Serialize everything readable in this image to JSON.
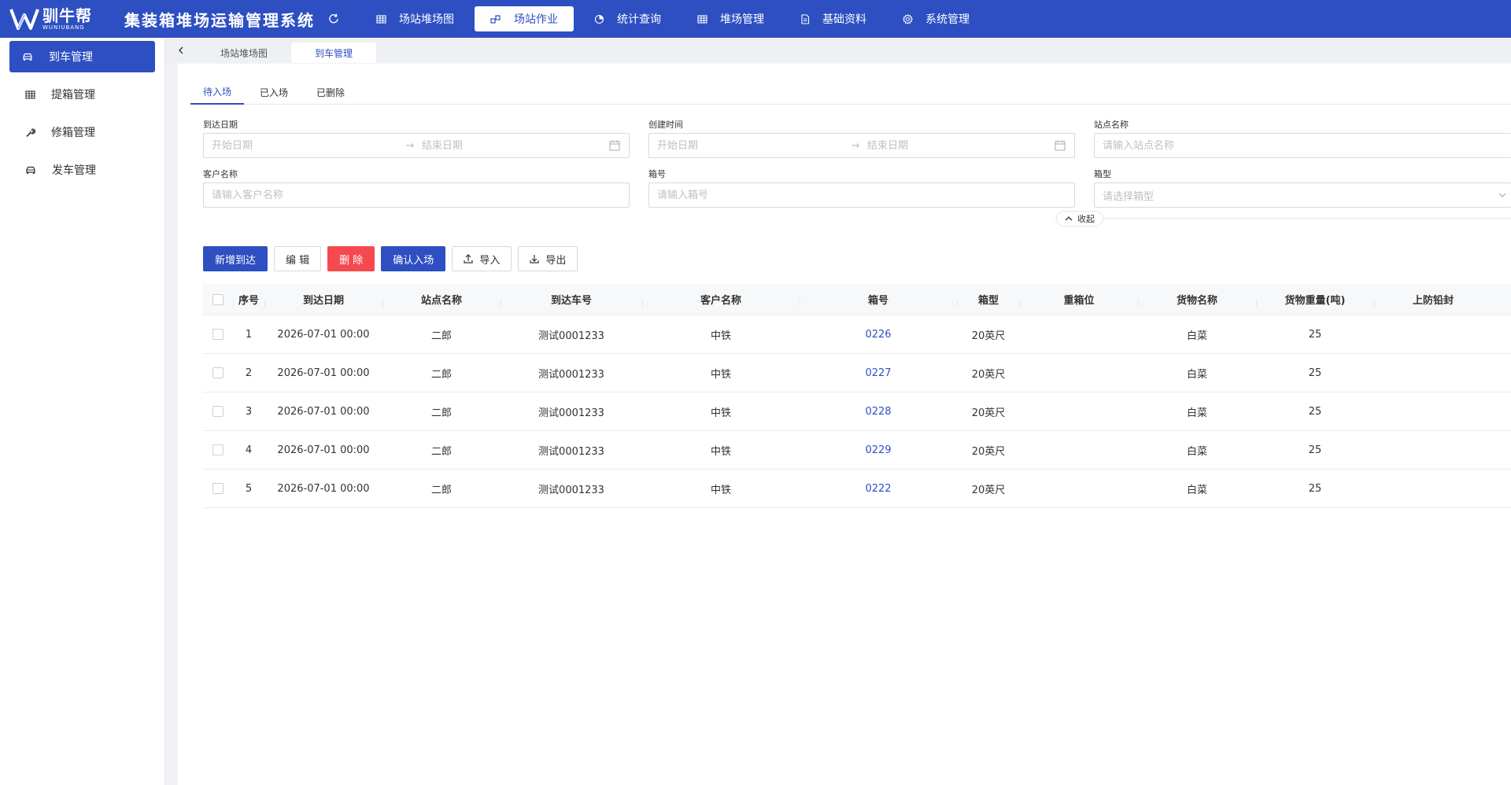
{
  "brand": {
    "name_cn": "驯牛帮",
    "name_en": "WUNIUBANG",
    "system_title": "集装箱堆场运输管理系统"
  },
  "colors": {
    "primary": "#2d4fc2",
    "danger": "#f5494f",
    "link": "#2d4fc2"
  },
  "nav": [
    {
      "label": "场站堆场图",
      "icon": "grid-icon",
      "active": false
    },
    {
      "label": "场站作业",
      "icon": "workflow-icon",
      "active": true
    },
    {
      "label": "统计查询",
      "icon": "pie-chart-icon",
      "active": false
    },
    {
      "label": "堆场管理",
      "icon": "grid-icon",
      "active": false
    },
    {
      "label": "基础资料",
      "icon": "document-icon",
      "active": false
    },
    {
      "label": "系统管理",
      "icon": "gear-icon",
      "active": false
    }
  ],
  "sidebar": [
    {
      "label": "到车管理",
      "icon": "car-icon",
      "active": true
    },
    {
      "label": "提箱管理",
      "icon": "grid-icon",
      "active": false
    },
    {
      "label": "修箱管理",
      "icon": "wrench-icon",
      "active": false
    },
    {
      "label": "发车管理",
      "icon": "car-icon",
      "active": false
    }
  ],
  "page_tabs": [
    {
      "label": "场站堆场图",
      "active": false
    },
    {
      "label": "到车管理",
      "active": true
    }
  ],
  "status_tabs": [
    {
      "label": "待入场",
      "active": true
    },
    {
      "label": "已入场",
      "active": false
    },
    {
      "label": "已删除",
      "active": false
    }
  ],
  "filters": {
    "arrival_date": {
      "label": "到达日期",
      "start_placeholder": "开始日期",
      "end_placeholder": "结束日期"
    },
    "created_time": {
      "label": "创建时间",
      "start_placeholder": "开始日期",
      "end_placeholder": "结束日期"
    },
    "station_name": {
      "label": "站点名称",
      "placeholder": "请输入站点名称"
    },
    "customer_name": {
      "label": "客户名称",
      "placeholder": "请输入客户名称"
    },
    "container_no": {
      "label": "箱号",
      "placeholder": "请输入箱号"
    },
    "container_type": {
      "label": "箱型",
      "placeholder": "请选择箱型"
    },
    "collapse_label": "收起"
  },
  "actions": {
    "add": "新增到达",
    "edit": "编 辑",
    "delete": "删 除",
    "confirm": "确认入场",
    "import": "导入",
    "export": "导出"
  },
  "table": {
    "columns": [
      "序号",
      "到达日期",
      "站点名称",
      "到达车号",
      "客户名称",
      "箱号",
      "箱型",
      "重箱位",
      "货物名称",
      "货物重量(吨)",
      "上防铅封"
    ],
    "rows": [
      [
        "1",
        "2026-07-01 00:00",
        "二郎",
        "测试0001233",
        "中铁",
        "0226",
        "20英尺",
        "",
        "白菜",
        "25",
        ""
      ],
      [
        "2",
        "2026-07-01 00:00",
        "二郎",
        "测试0001233",
        "中铁",
        "0227",
        "20英尺",
        "",
        "白菜",
        "25",
        ""
      ],
      [
        "3",
        "2026-07-01 00:00",
        "二郎",
        "测试0001233",
        "中铁",
        "0228",
        "20英尺",
        "",
        "白菜",
        "25",
        ""
      ],
      [
        "4",
        "2026-07-01 00:00",
        "二郎",
        "测试0001233",
        "中铁",
        "0229",
        "20英尺",
        "",
        "白菜",
        "25",
        ""
      ],
      [
        "5",
        "2026-07-01 00:00",
        "二郎",
        "测试0001233",
        "中铁",
        "0222",
        "20英尺",
        "",
        "白菜",
        "25",
        ""
      ]
    ]
  }
}
